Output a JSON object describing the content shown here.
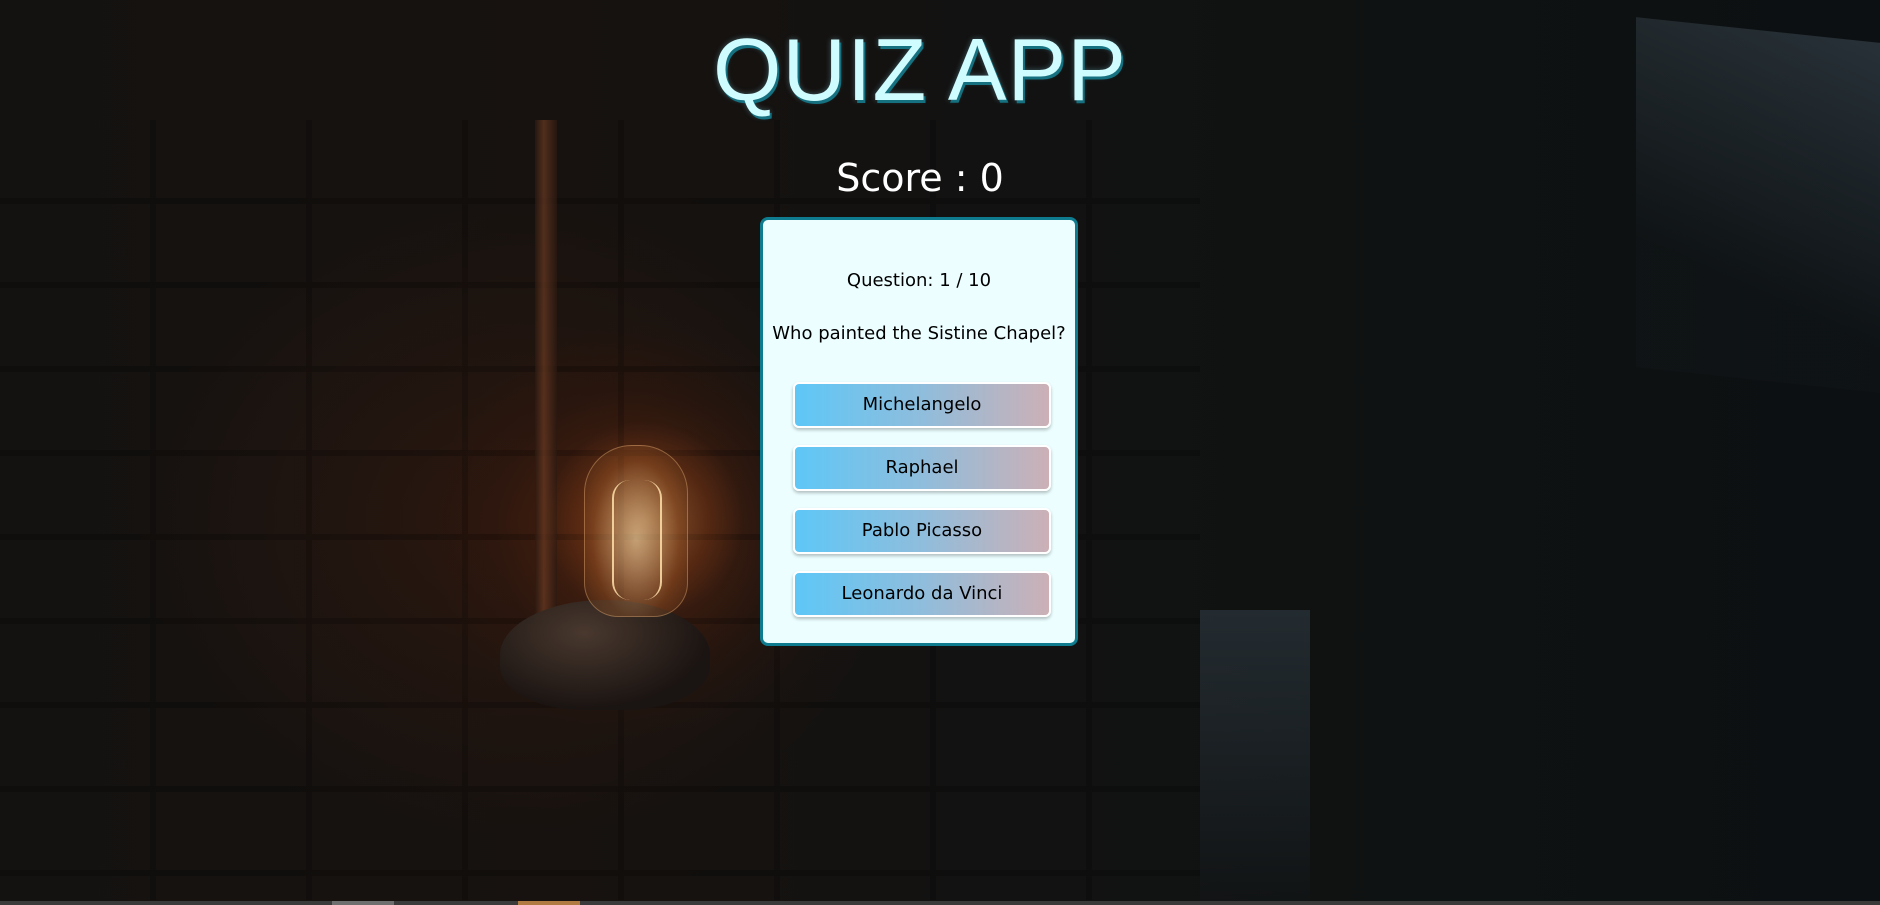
{
  "app": {
    "title": "QUIZ APP",
    "score_label": "Score : 0"
  },
  "quiz": {
    "question_count": "Question: 1 / 10",
    "question": "Who painted the Sistine Chapel?",
    "answers": [
      {
        "label": "Michelangelo"
      },
      {
        "label": "Raphael"
      },
      {
        "label": "Pablo Picasso"
      },
      {
        "label": "Leonardo da Vinci"
      }
    ]
  },
  "colors": {
    "title": "#cffcff",
    "title_shadow": "#15707f",
    "card_bg": "#ecfeff",
    "card_border": "#0e7c8e",
    "answer_gradient_start": "#5ec7f7",
    "answer_gradient_end": "#ccb0b6"
  },
  "background": {
    "description_icon": "edison-bulb-on-brick-wall-image"
  }
}
